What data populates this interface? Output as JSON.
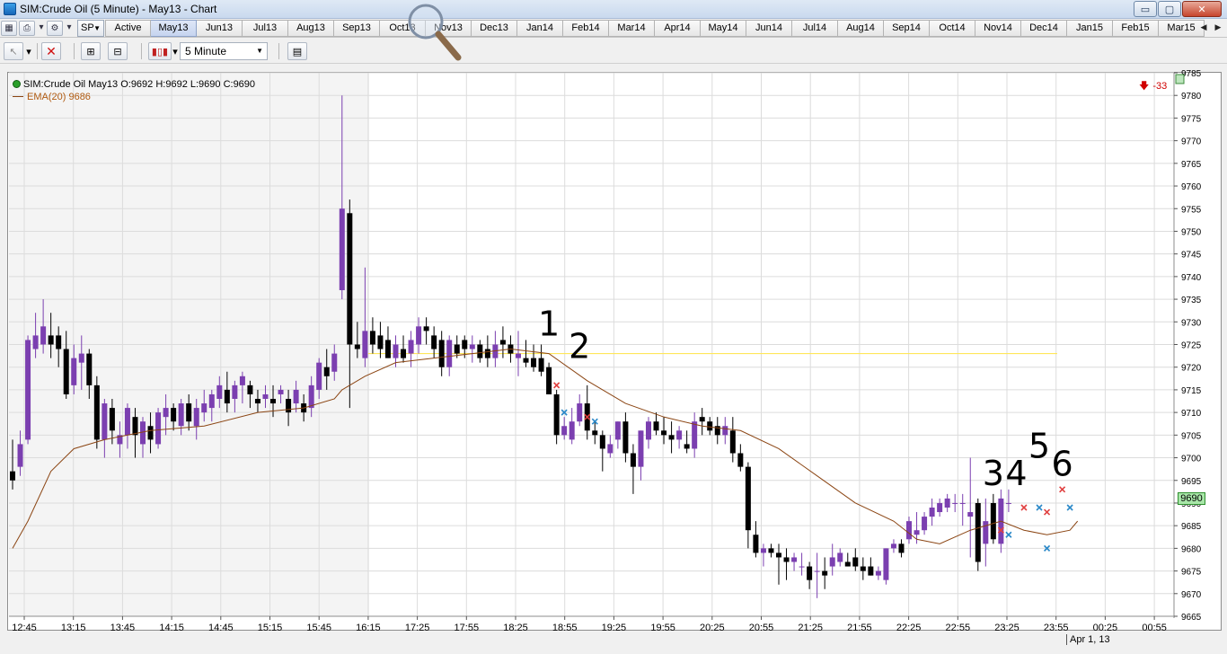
{
  "window": {
    "title": "SIM:Crude Oil (5 Minute) - May13 - Chart",
    "min_glyph": "▭",
    "max_glyph": "▢",
    "close_glyph": "✕"
  },
  "contract_strip": {
    "sp_label": "SP",
    "tabs": [
      "Active",
      "May13",
      "Jun13",
      "Jul13",
      "Aug13",
      "Sep13",
      "Oct13",
      "Nov13",
      "Dec13",
      "Jan14",
      "Feb14",
      "Mar14",
      "Apr14",
      "May14",
      "Jun14",
      "Jul14",
      "Aug14",
      "Sep14",
      "Oct14",
      "Nov14",
      "Dec14",
      "Jan15",
      "Feb15",
      "Mar15"
    ],
    "selected_tab": "May13"
  },
  "toolbar": {
    "interval": "5 Minute"
  },
  "legend": {
    "instrument": "SIM:Crude Oil May13 O:9692 H:9692 L:9690 C:9690",
    "ema": "EMA(20)  9686"
  },
  "pnl": "-33",
  "price_tag": "9690",
  "date_label": "Apr 1, 13",
  "annotations": [
    "1",
    "2",
    "3",
    "4",
    "5",
    "6"
  ],
  "colors": {
    "bull": "#7b3fb0",
    "bear": "#000000",
    "ema": "#8b4513",
    "hline": "#ffe75a",
    "session_bg": "#f4f4f4",
    "grid": "#dcdcdc",
    "sell_marker": "#e04040",
    "buy_marker": "#2a88c8"
  },
  "chart_data": {
    "type": "candlestick",
    "ylim": [
      9665,
      9785
    ],
    "y_ticks": [
      9665,
      9670,
      9675,
      9680,
      9685,
      9690,
      9695,
      9700,
      9705,
      9710,
      9715,
      9720,
      9725,
      9730,
      9735,
      9740,
      9745,
      9750,
      9755,
      9760,
      9765,
      9770,
      9775,
      9780,
      9785
    ],
    "x_ticks": [
      "12:45",
      "13:15",
      "13:45",
      "14:15",
      "14:45",
      "15:15",
      "15:45",
      "16:15",
      "17:25",
      "17:55",
      "18:25",
      "18:55",
      "19:25",
      "19:55",
      "20:25",
      "20:55",
      "21:25",
      "21:55",
      "22:25",
      "22:55",
      "23:25",
      "23:55",
      "00:25",
      "00:55"
    ],
    "horizontal_line": 9723,
    "candles": [
      [
        9697,
        9704,
        9693,
        9695
      ],
      [
        9698,
        9706,
        9696,
        9703
      ],
      [
        9704,
        9727,
        9703,
        9726
      ],
      [
        9724,
        9732,
        9722,
        9727
      ],
      [
        9725,
        9735,
        9723,
        9729
      ],
      [
        9727,
        9732,
        9722,
        9725
      ],
      [
        9727,
        9729,
        9720,
        9724
      ],
      [
        9724,
        9728,
        9713,
        9714
      ],
      [
        9716,
        9725,
        9714,
        9722
      ],
      [
        9721,
        9727,
        9715,
        9723
      ],
      [
        9723,
        9724,
        9713,
        9716
      ],
      [
        9716,
        9718,
        9702,
        9704
      ],
      [
        9704,
        9713,
        9700,
        9712
      ],
      [
        9711,
        9713,
        9703,
        9706
      ],
      [
        9703,
        9708,
        9700,
        9705
      ],
      [
        9705,
        9712,
        9702,
        9711
      ],
      [
        9709,
        9711,
        9700,
        9705
      ],
      [
        9703,
        9709,
        9700,
        9708
      ],
      [
        9707,
        9710,
        9701,
        9704
      ],
      [
        9703,
        9711,
        9702,
        9710
      ],
      [
        9709,
        9714,
        9705,
        9711
      ],
      [
        9711,
        9712,
        9706,
        9708
      ],
      [
        9707,
        9713,
        9705,
        9712
      ],
      [
        9712,
        9714,
        9706,
        9708
      ],
      [
        9707,
        9713,
        9704,
        9711
      ],
      [
        9710,
        9715,
        9708,
        9712
      ],
      [
        9711,
        9715,
        9708,
        9714
      ],
      [
        9713,
        9718,
        9711,
        9716
      ],
      [
        9715,
        9719,
        9710,
        9712
      ],
      [
        9713,
        9717,
        9710,
        9716
      ],
      [
        9716,
        9719,
        9712,
        9718
      ],
      [
        9716,
        9717,
        9711,
        9714
      ],
      [
        9713,
        9715,
        9710,
        9712
      ],
      [
        9713,
        9716,
        9711,
        9714
      ],
      [
        9713,
        9716,
        9709,
        9712
      ],
      [
        9714,
        9716,
        9712,
        9715
      ],
      [
        9713,
        9715,
        9707,
        9710
      ],
      [
        9712,
        9717,
        9710,
        9715
      ],
      [
        9712,
        9714,
        9708,
        9710
      ],
      [
        9711,
        9718,
        9709,
        9716
      ],
      [
        9715,
        9722,
        9713,
        9721
      ],
      [
        9720,
        9724,
        9715,
        9718
      ],
      [
        9719,
        9725,
        9717,
        9723
      ],
      [
        9737,
        9780,
        9735,
        9755
      ],
      [
        9754,
        9757,
        9711,
        9725
      ],
      [
        9725,
        9730,
        9722,
        9724
      ],
      [
        9722,
        9742,
        9720,
        9728
      ],
      [
        9728,
        9731,
        9723,
        9725
      ],
      [
        9727,
        9730,
        9722,
        9724
      ],
      [
        9726,
        9729,
        9722,
        9722
      ],
      [
        9722,
        9727,
        9720,
        9725
      ],
      [
        9724,
        9727,
        9721,
        9722
      ],
      [
        9723,
        9728,
        9720,
        9726
      ],
      [
        9725,
        9731,
        9723,
        9729
      ],
      [
        9729,
        9731,
        9725,
        9728
      ],
      [
        9727,
        9729,
        9722,
        9724
      ],
      [
        9726,
        9728,
        9718,
        9720
      ],
      [
        9720,
        9727,
        9718,
        9726
      ],
      [
        9725,
        9727,
        9722,
        9723
      ],
      [
        9726,
        9727,
        9722,
        9724
      ],
      [
        9724,
        9727,
        9721,
        9725
      ],
      [
        9725,
        9726,
        9721,
        9722
      ],
      [
        9724,
        9727,
        9720,
        9722
      ],
      [
        9722,
        9728,
        9720,
        9725
      ],
      [
        9726,
        9729,
        9722,
        9725
      ],
      [
        9725,
        9727,
        9721,
        9723
      ],
      [
        9722,
        9728,
        9718,
        9723
      ],
      [
        9722,
        9726,
        9720,
        9721
      ],
      [
        9722,
        9725,
        9719,
        9720
      ],
      [
        9722,
        9725,
        9718,
        9719
      ],
      [
        9720,
        9721,
        9714,
        9714
      ],
      [
        9714,
        9715,
        9703,
        9705
      ],
      [
        9705,
        9709,
        9704,
        9707
      ],
      [
        9704,
        9711,
        9703,
        9708
      ],
      [
        9708,
        9714,
        9707,
        9712
      ],
      [
        9712,
        9716,
        9704,
        9706
      ],
      [
        9706,
        9708,
        9703,
        9705
      ],
      [
        9705,
        9706,
        9697,
        9702
      ],
      [
        9701,
        9705,
        9700,
        9703
      ],
      [
        9704,
        9708,
        9702,
        9708
      ],
      [
        9708,
        9710,
        9699,
        9701
      ],
      [
        9701,
        9703,
        9692,
        9698
      ],
      [
        9698,
        9706,
        9695,
        9706
      ],
      [
        9704,
        9709,
        9702,
        9708
      ],
      [
        9708,
        9710,
        9705,
        9706
      ],
      [
        9706,
        9709,
        9703,
        9705
      ],
      [
        9705,
        9708,
        9701,
        9704
      ],
      [
        9704,
        9707,
        9702,
        9706
      ],
      [
        9703,
        9706,
        9701,
        9702
      ],
      [
        9702,
        9710,
        9700,
        9708
      ],
      [
        9709,
        9711,
        9705,
        9708
      ],
      [
        9708,
        9709,
        9705,
        9706
      ],
      [
        9707,
        9709,
        9703,
        9705
      ],
      [
        9705,
        9709,
        9703,
        9707
      ],
      [
        9706,
        9709,
        9699,
        9701
      ],
      [
        9701,
        9703,
        9697,
        9698
      ],
      [
        9698,
        9699,
        9680,
        9684
      ],
      [
        9683,
        9686,
        9678,
        9679
      ],
      [
        9679,
        9681,
        9676,
        9680
      ],
      [
        9680,
        9681,
        9678,
        9679
      ],
      [
        9679,
        9681,
        9672,
        9678
      ],
      [
        9678,
        9680,
        9673,
        9677
      ],
      [
        9677,
        9679,
        9675,
        9678
      ],
      [
        9676,
        9679,
        9674,
        9676
      ],
      [
        9676,
        9677,
        9671,
        9673
      ],
      [
        9675,
        9679,
        9669,
        9675
      ],
      [
        9675,
        9678,
        9671,
        9674
      ],
      [
        9676,
        9681,
        9674,
        9678
      ],
      [
        9677,
        9680,
        9676,
        9679
      ],
      [
        9677,
        9679,
        9676,
        9676
      ],
      [
        9678,
        9680,
        9675,
        9676
      ],
      [
        9676,
        9678,
        9673,
        9675
      ],
      [
        9676,
        9678,
        9674,
        9674
      ],
      [
        9674,
        9676,
        9673,
        9675
      ],
      [
        9673,
        9680,
        9672,
        9680
      ],
      [
        9680,
        9682,
        9679,
        9681
      ],
      [
        9681,
        9682,
        9678,
        9679
      ],
      [
        9682,
        9687,
        9681,
        9686
      ],
      [
        9683,
        9688,
        9681,
        9684
      ],
      [
        9684,
        9688,
        9683,
        9687
      ],
      [
        9687,
        9691,
        9685,
        9689
      ],
      [
        9688,
        9691,
        9687,
        9690
      ],
      [
        9689,
        9692,
        9688,
        9691
      ],
      [
        9690,
        9692,
        9688,
        9690
      ],
      [
        9690,
        9692,
        9685,
        9690
      ],
      [
        9687,
        9700,
        9678,
        9688
      ],
      [
        9690,
        9691,
        9675,
        9677
      ],
      [
        9681,
        9691,
        9676,
        9686
      ],
      [
        9690,
        9692,
        9681,
        9682
      ],
      [
        9681,
        9693,
        9679,
        9691
      ],
      [
        9690,
        9693,
        9688,
        9690
      ]
    ],
    "ema": [
      [
        0,
        9680
      ],
      [
        2,
        9686
      ],
      [
        5,
        9697
      ],
      [
        8,
        9702
      ],
      [
        12,
        9704
      ],
      [
        18,
        9706
      ],
      [
        25,
        9707
      ],
      [
        32,
        9710
      ],
      [
        38,
        9711
      ],
      [
        42,
        9713
      ],
      [
        43,
        9715
      ],
      [
        46,
        9718
      ],
      [
        50,
        9721
      ],
      [
        55,
        9722
      ],
      [
        60,
        9723
      ],
      [
        65,
        9724
      ],
      [
        70,
        9723
      ],
      [
        75,
        9717
      ],
      [
        80,
        9712
      ],
      [
        85,
        9709
      ],
      [
        90,
        9707
      ],
      [
        95,
        9706
      ],
      [
        100,
        9702
      ],
      [
        105,
        9696
      ],
      [
        110,
        9690
      ],
      [
        115,
        9686
      ],
      [
        118,
        9682
      ],
      [
        121,
        9681
      ],
      [
        125,
        9684
      ],
      [
        129,
        9686
      ],
      [
        132,
        9684
      ],
      [
        135,
        9683
      ],
      [
        138,
        9684
      ],
      [
        139,
        9686
      ]
    ],
    "trade_markers": [
      {
        "bar": 71,
        "price": 9716,
        "side": "sell"
      },
      {
        "bar": 72,
        "price": 9710,
        "side": "buy"
      },
      {
        "bar": 75,
        "price": 9709,
        "side": "sell"
      },
      {
        "bar": 76,
        "price": 9708,
        "side": "buy"
      },
      {
        "bar": 129,
        "price": 9684,
        "side": "sell"
      },
      {
        "bar": 130,
        "price": 9683,
        "side": "buy"
      },
      {
        "bar": 132,
        "price": 9689,
        "side": "sell"
      },
      {
        "bar": 134,
        "price": 9689,
        "side": "buy"
      },
      {
        "bar": 135,
        "price": 9688,
        "side": "sell"
      },
      {
        "bar": 135,
        "price": 9680,
        "side": "buy"
      },
      {
        "bar": 137,
        "price": 9693,
        "side": "sell"
      },
      {
        "bar": 138,
        "price": 9689,
        "side": "buy"
      }
    ],
    "annotation_positions": [
      {
        "label": "1",
        "bar": 70,
        "price": 9727
      },
      {
        "label": "2",
        "bar": 74,
        "price": 9722
      },
      {
        "label": "3",
        "bar": 128,
        "price": 9694
      },
      {
        "label": "4",
        "bar": 131,
        "price": 9694
      },
      {
        "label": "5",
        "bar": 134,
        "price": 9700
      },
      {
        "label": "6",
        "bar": 137,
        "price": 9696
      }
    ]
  }
}
